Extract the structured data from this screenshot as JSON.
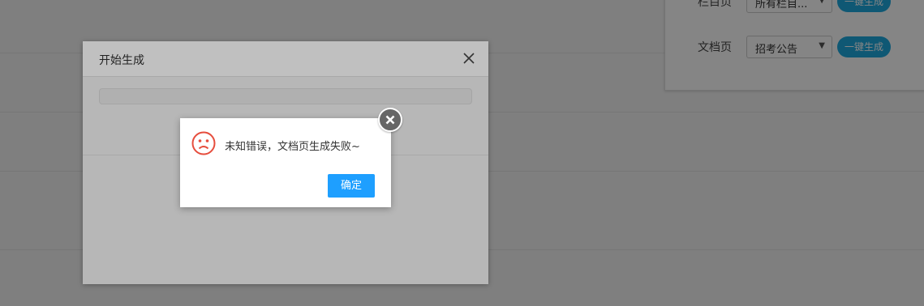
{
  "generate_panel": {
    "rows": [
      {
        "label": "栏目页",
        "select_value": "所有栏目...",
        "button_label": "一键生成"
      },
      {
        "label": "文档页",
        "select_value": "招考公告",
        "button_label": "一键生成"
      }
    ]
  },
  "progress_dialog": {
    "title": "开始生成",
    "progress": 0
  },
  "alert": {
    "message": "未知错误，文档页生成失败~",
    "ok_label": "确定"
  },
  "icons": {
    "alert_icon": "sad-face-icon",
    "dialog_close": "close-icon",
    "alert_close": "close-circle-icon"
  }
}
